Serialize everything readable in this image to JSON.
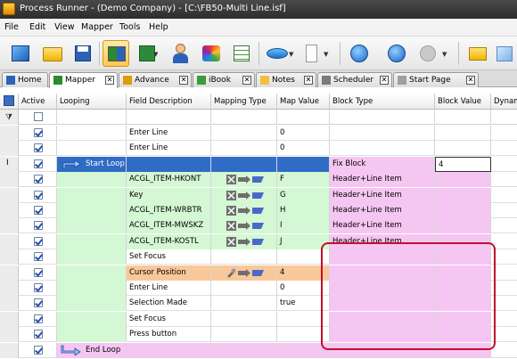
{
  "window": {
    "title": "Process Runner - (Demo Company) - [C:\\FB50-Multi Line.isf]"
  },
  "menu": [
    "File",
    "Edit",
    "View",
    "Mapper",
    "Tools",
    "Help"
  ],
  "tabs": [
    {
      "label": "Home"
    },
    {
      "label": "Mapper"
    },
    {
      "label": "Advance"
    },
    {
      "label": "iBook"
    },
    {
      "label": "Notes"
    },
    {
      "label": "Scheduler"
    },
    {
      "label": "Start Page"
    }
  ],
  "grid": {
    "columns": [
      "Active",
      "Looping",
      "Field Description",
      "Mapping Type",
      "Map Value",
      "Block Type",
      "Block Value",
      "Dynam"
    ],
    "rows": [
      {
        "looping": "",
        "field": "Enter Line",
        "map_type": "",
        "map_value": "0",
        "block_type": "",
        "block_value": "",
        "style": "plain"
      },
      {
        "looping": "",
        "field": "Enter Line",
        "map_type": "",
        "map_value": "0",
        "block_type": "",
        "block_value": "",
        "style": "plain"
      },
      {
        "looping": "Start Loop",
        "field": "",
        "map_type": "",
        "map_value": "",
        "block_type": "Fix Block",
        "block_value": "4",
        "style": "selected"
      },
      {
        "looping": "",
        "field": "ACGL_ITEM-HKONT",
        "map_type": "excel-map",
        "map_value": "F",
        "block_type": "Header+Line Item",
        "block_value": "",
        "style": "green"
      },
      {
        "looping": "",
        "field": "Key",
        "map_type": "excel-map",
        "map_value": "G",
        "block_type": "Header+Line Item",
        "block_value": "",
        "style": "green"
      },
      {
        "looping": "",
        "field": "ACGL_ITEM-WRBTR",
        "map_type": "excel-map",
        "map_value": "H",
        "block_type": "Header+Line Item",
        "block_value": "",
        "style": "green"
      },
      {
        "looping": "",
        "field": "ACGL_ITEM-MWSKZ",
        "map_type": "excel-map",
        "map_value": "I",
        "block_type": "Header+Line Item",
        "block_value": "",
        "style": "green"
      },
      {
        "looping": "",
        "field": "ACGL_ITEM-KOSTL",
        "map_type": "excel-map",
        "map_value": "J",
        "block_type": "Header+Line Item",
        "block_value": "",
        "style": "green"
      },
      {
        "looping": "",
        "field": "Set Focus",
        "map_type": "",
        "map_value": "",
        "block_type": "",
        "block_value": "",
        "style": "inloop"
      },
      {
        "looping": "",
        "field": "Cursor Position",
        "map_type": "cursor-map",
        "map_value": "4",
        "block_type": "",
        "block_value": "",
        "style": "orange"
      },
      {
        "looping": "",
        "field": "Enter Line",
        "map_type": "",
        "map_value": "0",
        "block_type": "",
        "block_value": "",
        "style": "inloop"
      },
      {
        "looping": "",
        "field": "Selection Made",
        "map_type": "",
        "map_value": "true",
        "block_type": "",
        "block_value": "",
        "style": "inloop"
      },
      {
        "looping": "",
        "field": "Set Focus",
        "map_type": "",
        "map_value": "",
        "block_type": "",
        "block_value": "",
        "style": "inloop"
      },
      {
        "looping": "",
        "field": "Press button",
        "map_type": "",
        "map_value": "",
        "block_type": "",
        "block_value": "",
        "style": "inloop"
      },
      {
        "looping": "End Loop",
        "field": "",
        "map_type": "",
        "map_value": "",
        "block_type": "",
        "block_value": "",
        "style": "endloop"
      }
    ]
  },
  "colors": {
    "selected": "#2f6cc6",
    "loop_green": "#d4f7d4",
    "loop_pink": "#f6c6f2",
    "cursor_orange": "#f8c89a",
    "highlight": "#c0102a"
  }
}
